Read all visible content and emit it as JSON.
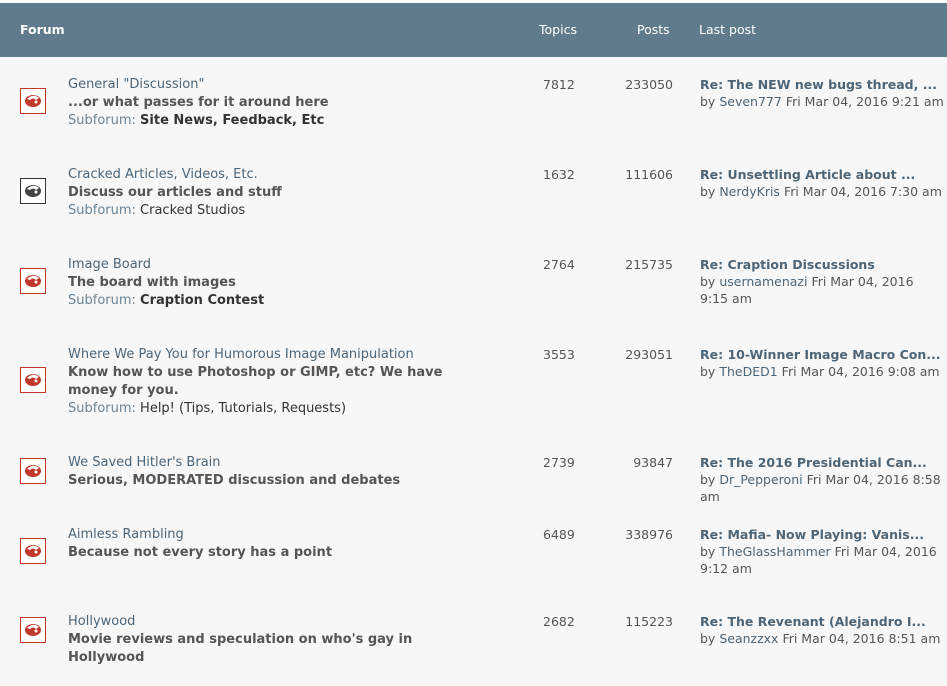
{
  "header": {
    "forum": "Forum",
    "topics": "Topics",
    "posts": "Posts",
    "last_post": "Last post"
  },
  "forums": [
    {
      "title": "General \"Discussion\"",
      "desc": "...or what passes for it around here",
      "sub_label": "Subforum:",
      "sub": "Site News, Feedback, Etc",
      "topics": "7812",
      "posts": "233050",
      "lp_title": "Re: The NEW new bugs thread, ...",
      "by": "by",
      "user": "Seven777",
      "date": "Fri Mar 04, 2016 9:21 am"
    },
    {
      "title": "Cracked Articles, Videos, Etc.",
      "desc": "Discuss our articles and stuff",
      "sub_label": "Subforum:",
      "sub": "Cracked Studios",
      "topics": "1632",
      "posts": "111606",
      "lp_title": "Re: Unsettling Article about ...",
      "by": "by",
      "user": "NerdyKris",
      "date": "Fri Mar 04, 2016 7:30 am"
    },
    {
      "title": "Image Board",
      "desc": "The board with images",
      "sub_label": "Subforum:",
      "sub": "Craption Contest",
      "topics": "2764",
      "posts": "215735",
      "lp_title": "Re: Craption Discussions",
      "by": "by",
      "user": "usernamenazi",
      "date": "Fri Mar 04, 2016 9:15 am"
    },
    {
      "title": "Where We Pay You for Humorous Image Manipulation",
      "desc": "Know how to use Photoshop or GIMP, etc? We have money for you.",
      "sub_label": "Subforum:",
      "sub": "Help! (Tips, Tutorials, Requests)",
      "topics": "3553",
      "posts": "293051",
      "lp_title": "Re: 10-Winner Image Macro Con...",
      "by": "by",
      "user": "TheDED1",
      "date": "Fri Mar 04, 2016 9:08 am"
    },
    {
      "title": "We Saved Hitler's Brain",
      "desc": "Serious, MODERATED discussion and debates",
      "topics": "2739",
      "posts": "93847",
      "lp_title": "Re: The 2016 Presidential Can...",
      "by": "by",
      "user": "Dr_Pepperoni",
      "date": "Fri Mar 04, 2016 8:58 am"
    },
    {
      "title": "Aimless Rambling",
      "desc": "Because not every story has a point",
      "topics": "6489",
      "posts": "338976",
      "lp_title": "Re: Mafia- Now Playing: Vanis...",
      "by": "by",
      "user": "TheGlassHammer",
      "date": "Fri Mar 04, 2016 9:12 am"
    },
    {
      "title": "Hollywood",
      "desc": "Movie reviews and speculation on who's gay in Hollywood",
      "topics": "2682",
      "posts": "115223",
      "lp_title": "Re: The Revenant (Alejandro I...",
      "by": "by",
      "user": "Seanzzxx",
      "date": "Fri Mar 04, 2016 8:51 am"
    }
  ],
  "colors": {
    "header_bg": "#5f7b8c",
    "link": "#4d6577",
    "icon_border": "#c0392b"
  },
  "icons": {
    "forum_unread": "cracked-logo-icon",
    "forum_read": "cracked-logo-icon-dark"
  }
}
